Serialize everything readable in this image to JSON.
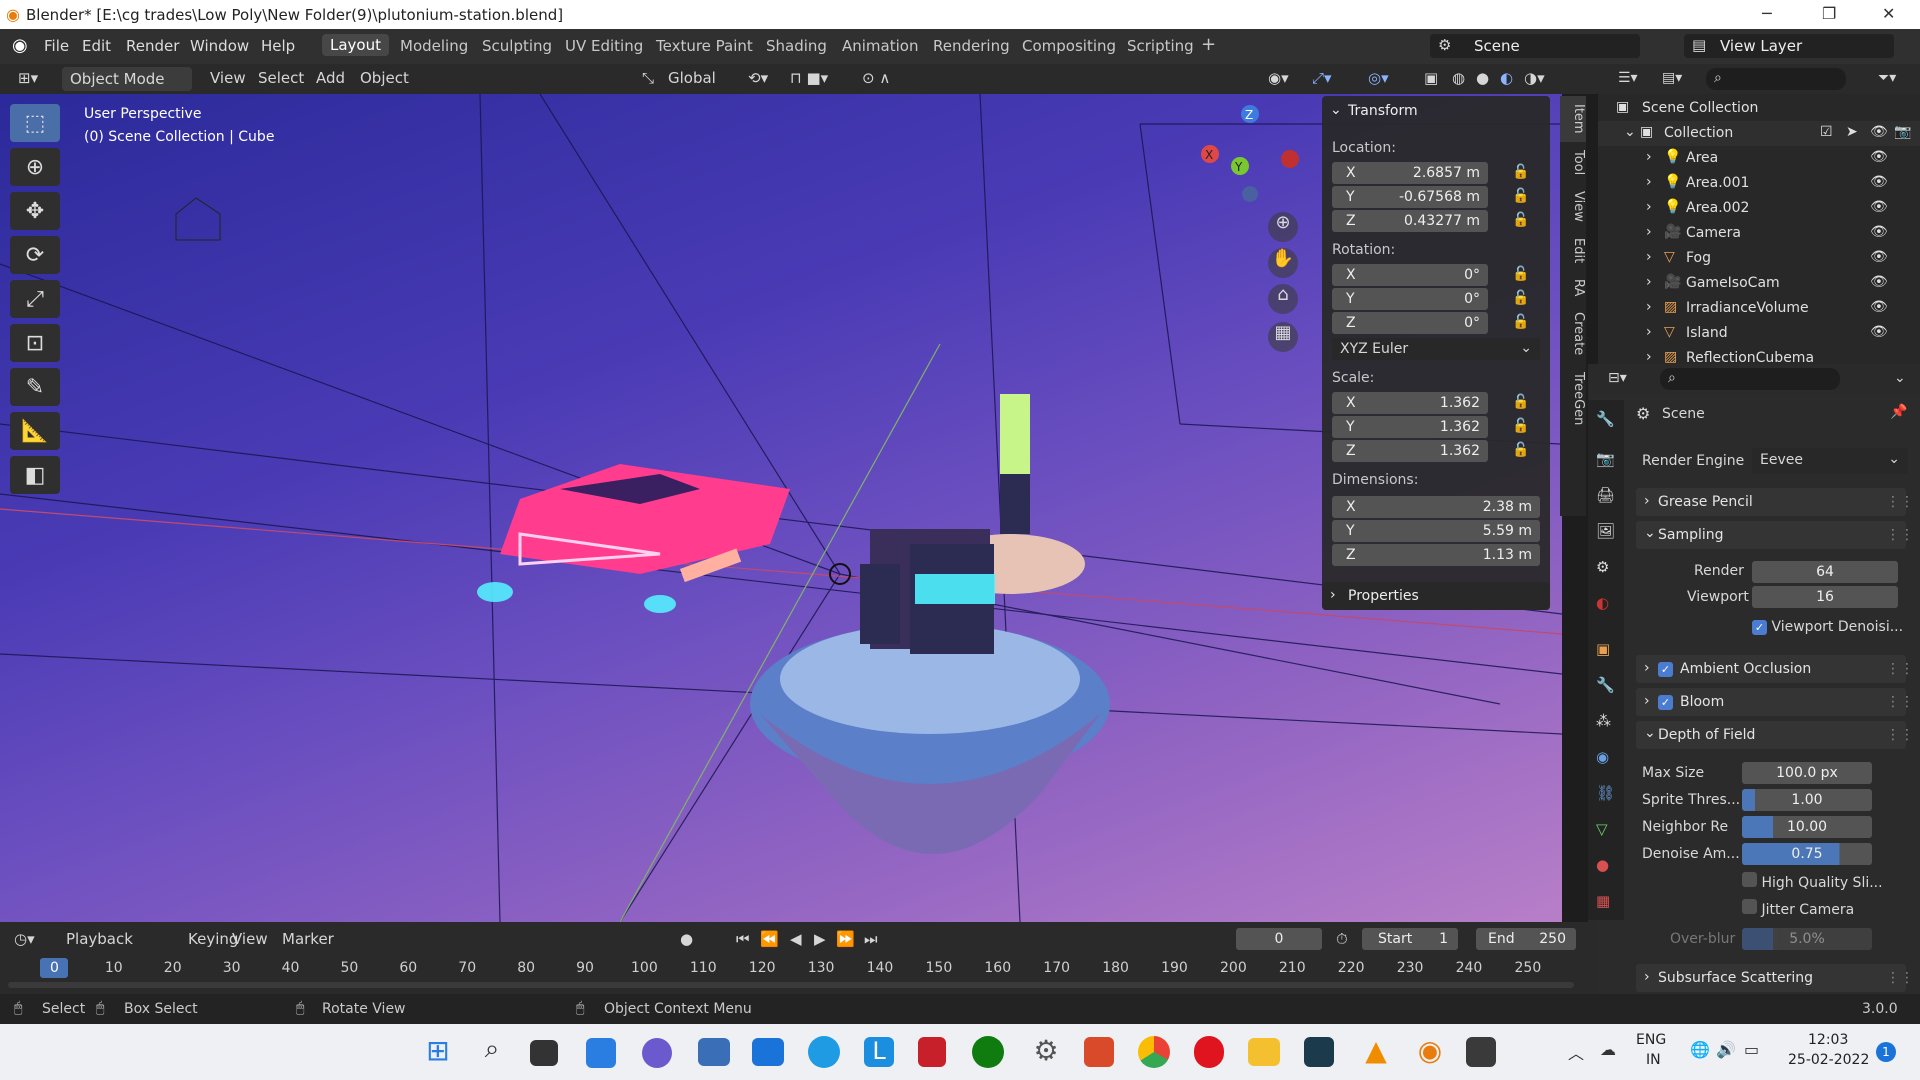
{
  "title_bar": {
    "title": "Blender* [E:\\cg trades\\Low Poly\\New Folder(9)\\plutonium-station.blend]",
    "minimize": "─",
    "maximize": "❐",
    "close": "✕"
  },
  "menu": {
    "items": [
      "File",
      "Edit",
      "Render",
      "Window",
      "Help"
    ],
    "workspaces": [
      "Layout",
      "Modeling",
      "Sculpting",
      "UV Editing",
      "Texture Paint",
      "Shading",
      "Animation",
      "Rendering",
      "Compositing",
      "Scripting"
    ],
    "add_tab": "+",
    "scene": "Scene",
    "view_layer": "View Layer"
  },
  "header": {
    "mode": "Object Mode",
    "view": "View",
    "select": "Select",
    "add": "Add",
    "object": "Object",
    "orientation": "Global"
  },
  "viewport": {
    "perspective": "User Perspective",
    "collection": "(0) Scene Collection | Cube"
  },
  "transform": {
    "title": "Transform",
    "location_label": "Location:",
    "location": [
      {
        "axis": "X",
        "value": "2.6857 m"
      },
      {
        "axis": "Y",
        "value": "-0.67568 m"
      },
      {
        "axis": "Z",
        "value": "0.43277 m"
      }
    ],
    "rotation_label": "Rotation:",
    "rotation": [
      {
        "axis": "X",
        "value": "0°"
      },
      {
        "axis": "Y",
        "value": "0°"
      },
      {
        "axis": "Z",
        "value": "0°"
      }
    ],
    "rotation_mode": "XYZ Euler",
    "scale_label": "Scale:",
    "scale": [
      {
        "axis": "X",
        "value": "1.362"
      },
      {
        "axis": "Y",
        "value": "1.362"
      },
      {
        "axis": "Z",
        "value": "1.362"
      }
    ],
    "dimensions_label": "Dimensions:",
    "dimensions": [
      {
        "axis": "X",
        "value": "2.38 m"
      },
      {
        "axis": "Y",
        "value": "5.59 m"
      },
      {
        "axis": "Z",
        "value": "1.13 m"
      }
    ],
    "properties": "Properties"
  },
  "side_tabs": [
    "Item",
    "Tool",
    "View",
    "Edit",
    "RA",
    "Create",
    "TreeGen"
  ],
  "outliner": {
    "root": "Scene Collection",
    "collection": "Collection",
    "items": [
      "Area",
      "Area.001",
      "Area.002",
      "Camera",
      "Fog",
      "GameIsoCam",
      "IrradianceVolume",
      "Island",
      "ReflectionCubema"
    ]
  },
  "properties": {
    "scene": "Scene",
    "render_engine_label": "Render Engine",
    "render_engine": "Eevee",
    "grease_pencil": "Grease Pencil",
    "sampling": "Sampling",
    "render_label": "Render",
    "render_value": "64",
    "viewport_label": "Viewport",
    "viewport_value": "16",
    "viewport_denoise": "Viewport Denoisi...",
    "ambient_occlusion": "Ambient Occlusion",
    "bloom": "Bloom",
    "dof": "Depth of Field",
    "max_size_label": "Max Size",
    "max_size": "100.0 px",
    "sprite_label": "Sprite Thres...",
    "sprite": "1.00",
    "neighbor_label": "Neighbor Re",
    "neighbor": "10.00",
    "denoise_label": "Denoise Am...",
    "denoise": "0.75",
    "high_quality": "High Quality Sli...",
    "jitter": "Jitter Camera",
    "overblur_label": "Over-blur",
    "overblur": "5.0%",
    "sss": "Subsurface Scattering"
  },
  "timeline": {
    "playback": "Playback",
    "keying": "Keying",
    "view": "View",
    "marker": "Marker",
    "current_frame": "0",
    "start_label": "Start",
    "start": "1",
    "end_label": "End",
    "end": "250",
    "ticks": [
      "0",
      "10",
      "20",
      "30",
      "40",
      "50",
      "60",
      "70",
      "80",
      "90",
      "100",
      "110",
      "120",
      "130",
      "140",
      "150",
      "160",
      "170",
      "180",
      "190",
      "200",
      "210",
      "220",
      "230",
      "240",
      "250"
    ]
  },
  "status": {
    "select": "Select",
    "box_select": "Box Select",
    "rotate": "Rotate View",
    "context": "Object Context Menu",
    "version": "3.0.0"
  },
  "taskbar": {
    "lang1": "ENG",
    "lang2": "IN",
    "time": "12:03",
    "date": "25-02-2022",
    "badge": "1"
  }
}
